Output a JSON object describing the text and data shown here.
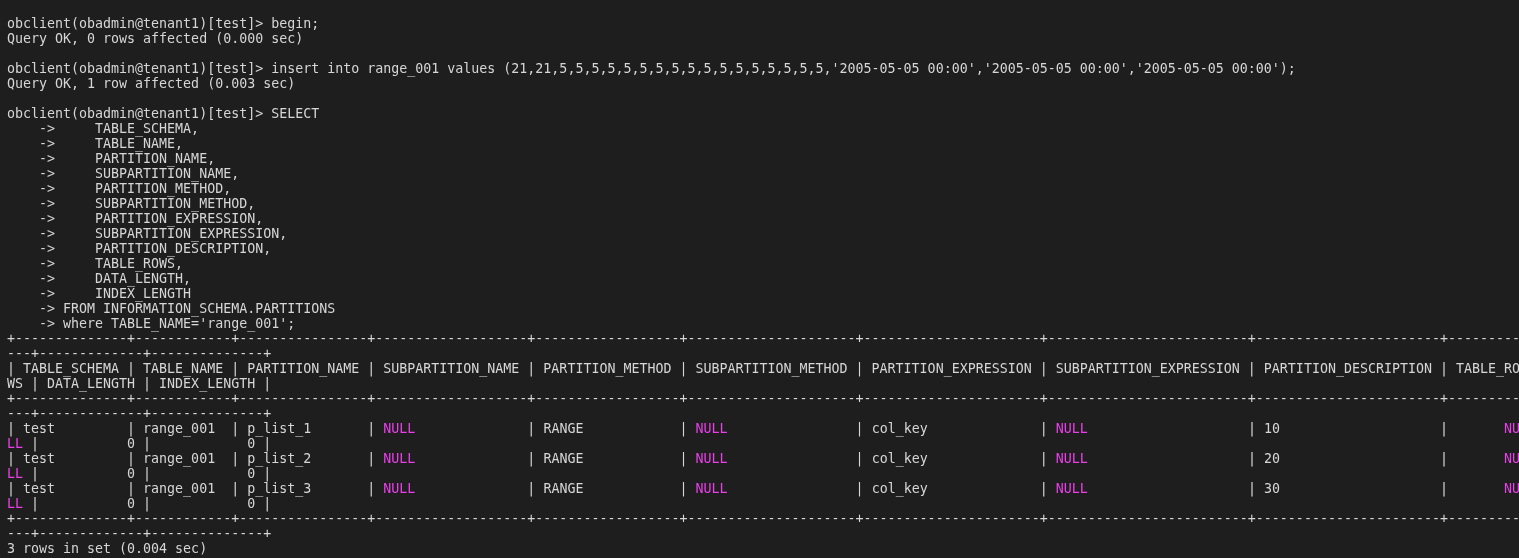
{
  "terminal": {
    "lines": [
      {
        "kind": "text",
        "parts": [
          {
            "kind": "plain",
            "text": "obclient(obadmin@tenant1)[test]> begin;"
          }
        ]
      },
      {
        "kind": "text",
        "parts": [
          {
            "kind": "plain",
            "text": "Query OK, 0 rows affected (0.000 sec)"
          }
        ]
      },
      {
        "kind": "blank"
      },
      {
        "kind": "text",
        "parts": [
          {
            "kind": "plain",
            "text": "obclient(obadmin@tenant1)[test]> insert into range_001 values (21,21,5,5,5,5,5,5,5,5,5,5,5,5,5,5,5,5,5,'2005-05-05 00:00','2005-05-05 00:00','2005-05-05 00:00');"
          }
        ]
      },
      {
        "kind": "text",
        "parts": [
          {
            "kind": "plain",
            "text": "Query OK, 1 row affected (0.003 sec)"
          }
        ]
      },
      {
        "kind": "blank"
      },
      {
        "kind": "text",
        "parts": [
          {
            "kind": "plain",
            "text": "obclient(obadmin@tenant1)[test]> SELECT"
          }
        ]
      },
      {
        "kind": "text",
        "parts": [
          {
            "kind": "plain",
            "text": "    ->     TABLE_SCHEMA,"
          }
        ]
      },
      {
        "kind": "text",
        "parts": [
          {
            "kind": "plain",
            "text": "    ->     TABLE_NAME,"
          }
        ]
      },
      {
        "kind": "text",
        "parts": [
          {
            "kind": "plain",
            "text": "    ->     PARTITION_NAME,"
          }
        ]
      },
      {
        "kind": "text",
        "parts": [
          {
            "kind": "plain",
            "text": "    ->     SUBPARTITION_NAME,"
          }
        ]
      },
      {
        "kind": "text",
        "parts": [
          {
            "kind": "plain",
            "text": "    ->     PARTITION_METHOD,"
          }
        ]
      },
      {
        "kind": "text",
        "parts": [
          {
            "kind": "plain",
            "text": "    ->     SUBPARTITION_METHOD,"
          }
        ]
      },
      {
        "kind": "text",
        "parts": [
          {
            "kind": "plain",
            "text": "    ->     PARTITION_EXPRESSION,"
          }
        ]
      },
      {
        "kind": "text",
        "parts": [
          {
            "kind": "plain",
            "text": "    ->     SUBPARTITION_EXPRESSION,"
          }
        ]
      },
      {
        "kind": "text",
        "parts": [
          {
            "kind": "plain",
            "text": "    ->     PARTITION_DESCRIPTION,"
          }
        ]
      },
      {
        "kind": "text",
        "parts": [
          {
            "kind": "plain",
            "text": "    ->     TABLE_ROWS,"
          }
        ]
      },
      {
        "kind": "text",
        "parts": [
          {
            "kind": "plain",
            "text": "    ->     DATA_LENGTH,"
          }
        ]
      },
      {
        "kind": "text",
        "parts": [
          {
            "kind": "plain",
            "text": "    ->     INDEX_LENGTH"
          }
        ]
      },
      {
        "kind": "text",
        "parts": [
          {
            "kind": "plain",
            "text": "    -> FROM INFORMATION_SCHEMA.PARTITIONS"
          }
        ]
      },
      {
        "kind": "text",
        "parts": [
          {
            "kind": "plain",
            "text": "    -> where TABLE_NAME='range_001';"
          }
        ]
      },
      {
        "kind": "text",
        "parts": [
          {
            "kind": "plain",
            "text": "+--------------+------------+----------------+-------------------+------------------+---------------------+----------------------+-------------------------+-----------------------+---------"
          }
        ]
      },
      {
        "kind": "text",
        "parts": [
          {
            "kind": "plain",
            "text": "---+-------------+--------------+"
          }
        ]
      },
      {
        "kind": "text",
        "parts": [
          {
            "kind": "plain",
            "text": "| TABLE_SCHEMA | TABLE_NAME | PARTITION_NAME | SUBPARTITION_NAME | PARTITION_METHOD | SUBPARTITION_METHOD | PARTITION_EXPRESSION | SUBPARTITION_EXPRESSION | PARTITION_DESCRIPTION | TABLE_RO"
          }
        ]
      },
      {
        "kind": "text",
        "parts": [
          {
            "kind": "plain",
            "text": "WS | DATA_LENGTH | INDEX_LENGTH |"
          }
        ]
      },
      {
        "kind": "text",
        "parts": [
          {
            "kind": "plain",
            "text": "+--------------+------------+----------------+-------------------+------------------+---------------------+----------------------+-------------------------+-----------------------+---------"
          }
        ]
      },
      {
        "kind": "text",
        "parts": [
          {
            "kind": "plain",
            "text": "---+-------------+--------------+"
          }
        ]
      },
      {
        "kind": "text",
        "parts": [
          {
            "kind": "plain",
            "text": "| test         | range_001  | p_list_1       | "
          },
          {
            "kind": "null",
            "text": "NULL"
          },
          {
            "kind": "plain",
            "text": "              | RANGE            | "
          },
          {
            "kind": "null",
            "text": "NULL"
          },
          {
            "kind": "plain",
            "text": "                | col_key              | "
          },
          {
            "kind": "null",
            "text": "NULL"
          },
          {
            "kind": "plain",
            "text": "                    | 10                    |       "
          },
          {
            "kind": "null",
            "text": "NU"
          }
        ]
      },
      {
        "kind": "text",
        "parts": [
          {
            "kind": "null",
            "text": "LL"
          },
          {
            "kind": "plain",
            "text": " |           0 |            0 |"
          }
        ]
      },
      {
        "kind": "text",
        "parts": [
          {
            "kind": "plain",
            "text": "| test         | range_001  | p_list_2       | "
          },
          {
            "kind": "null",
            "text": "NULL"
          },
          {
            "kind": "plain",
            "text": "              | RANGE            | "
          },
          {
            "kind": "null",
            "text": "NULL"
          },
          {
            "kind": "plain",
            "text": "                | col_key              | "
          },
          {
            "kind": "null",
            "text": "NULL"
          },
          {
            "kind": "plain",
            "text": "                    | 20                    |       "
          },
          {
            "kind": "null",
            "text": "NU"
          }
        ]
      },
      {
        "kind": "text",
        "parts": [
          {
            "kind": "null",
            "text": "LL"
          },
          {
            "kind": "plain",
            "text": " |           0 |            0 |"
          }
        ]
      },
      {
        "kind": "text",
        "parts": [
          {
            "kind": "plain",
            "text": "| test         | range_001  | p_list_3       | "
          },
          {
            "kind": "null",
            "text": "NULL"
          },
          {
            "kind": "plain",
            "text": "              | RANGE            | "
          },
          {
            "kind": "null",
            "text": "NULL"
          },
          {
            "kind": "plain",
            "text": "                | col_key              | "
          },
          {
            "kind": "null",
            "text": "NULL"
          },
          {
            "kind": "plain",
            "text": "                    | 30                    |       "
          },
          {
            "kind": "null",
            "text": "NU"
          }
        ]
      },
      {
        "kind": "text",
        "parts": [
          {
            "kind": "null",
            "text": "LL"
          },
          {
            "kind": "plain",
            "text": " |           0 |            0 |"
          }
        ]
      },
      {
        "kind": "text",
        "parts": [
          {
            "kind": "plain",
            "text": "+--------------+------------+----------------+-------------------+------------------+---------------------+----------------------+-------------------------+-----------------------+---------"
          }
        ]
      },
      {
        "kind": "text",
        "parts": [
          {
            "kind": "plain",
            "text": "---+-------------+--------------+"
          }
        ]
      },
      {
        "kind": "text",
        "parts": [
          {
            "kind": "plain",
            "text": "3 rows in set (0.004 sec)"
          }
        ]
      }
    ]
  }
}
